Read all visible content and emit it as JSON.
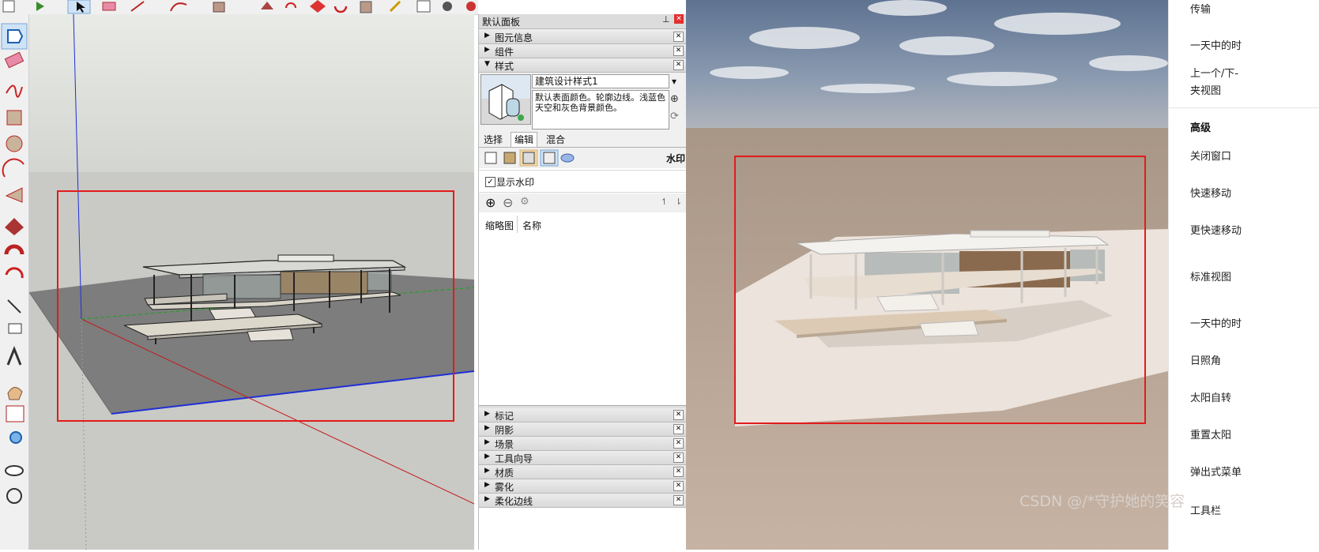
{
  "tray": {
    "title": "默认面板",
    "panels_top": [
      {
        "label": "图元信息"
      },
      {
        "label": "组件"
      },
      {
        "label": "样式"
      }
    ],
    "style": {
      "name": "建筑设计样式1",
      "description": "默认表面颜色。轮廓边线。浅蓝色天空和灰色背景颜色。",
      "tabs": [
        "选择",
        "编辑",
        "混合"
      ],
      "active_tab": "编辑",
      "section_label": "水印",
      "show_watermark_label": "显示水印",
      "show_watermark_checked": true,
      "columns": [
        "缩略图",
        "名称"
      ]
    },
    "panels_bottom": [
      {
        "label": "标记"
      },
      {
        "label": "阴影"
      },
      {
        "label": "场景"
      },
      {
        "label": "工具向导"
      },
      {
        "label": "材质"
      },
      {
        "label": "雾化"
      },
      {
        "label": "柔化边线"
      }
    ]
  },
  "settings": {
    "items": [
      "传输",
      "一天中的时",
      "上一个/下-",
      "夹视图",
      "高级",
      "关闭窗口",
      "快速移动",
      "更快速移动",
      "标准视图",
      "一天中的时",
      "日照角",
      "太阳自转",
      "重置太阳",
      "弹出式菜单",
      "工具栏"
    ]
  },
  "watermark": "CSDN @/*守护她的笑容",
  "colors": {
    "highlight_box": "#e21b1b",
    "axis_blue": "#1f2fd6",
    "axis_red": "#c41a1a",
    "axis_green": "#1aa31a"
  }
}
